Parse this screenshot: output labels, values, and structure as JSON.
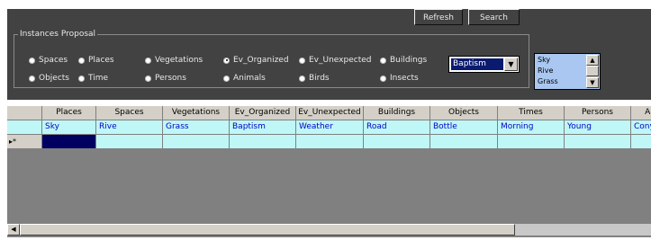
{
  "toolbar": {
    "refresh_label": "Refresh",
    "search_label": "Search"
  },
  "group": {
    "title": "Instances Proposal"
  },
  "radios": [
    {
      "label": "Spaces",
      "selected": false
    },
    {
      "label": "Places",
      "selected": false
    },
    {
      "label": "Vegetations",
      "selected": false
    },
    {
      "label": "Ev_Organized",
      "selected": true
    },
    {
      "label": "Ev_Unexpected",
      "selected": false
    },
    {
      "label": "Buildings",
      "selected": false
    },
    {
      "label": "Objects",
      "selected": false
    },
    {
      "label": "Time",
      "selected": false
    },
    {
      "label": "Persons",
      "selected": false
    },
    {
      "label": "Animals",
      "selected": false
    },
    {
      "label": "Birds",
      "selected": false
    },
    {
      "label": "Insects",
      "selected": false
    }
  ],
  "combo": {
    "value": "Baptism"
  },
  "listbox": {
    "items": [
      "Sky",
      "Rive",
      "Grass"
    ]
  },
  "table": {
    "columns": [
      "Places",
      "Spaces",
      "Vegetations",
      "Ev_Organized",
      "Ev_Unexpected",
      "Buildings",
      "Objects",
      "Times",
      "Persons",
      "An"
    ],
    "rows": [
      [
        "Sky",
        "Rive",
        "Grass",
        "Baptism",
        "Weather",
        "Road",
        "Bottle",
        "Morning",
        "Young",
        "Cony"
      ]
    ],
    "new_row_marker": "▸*"
  },
  "colors": {
    "panel": "#424242",
    "data_row": "#bff7f7",
    "selected_cell": "#000060",
    "listbox": "#a9c7f0"
  }
}
